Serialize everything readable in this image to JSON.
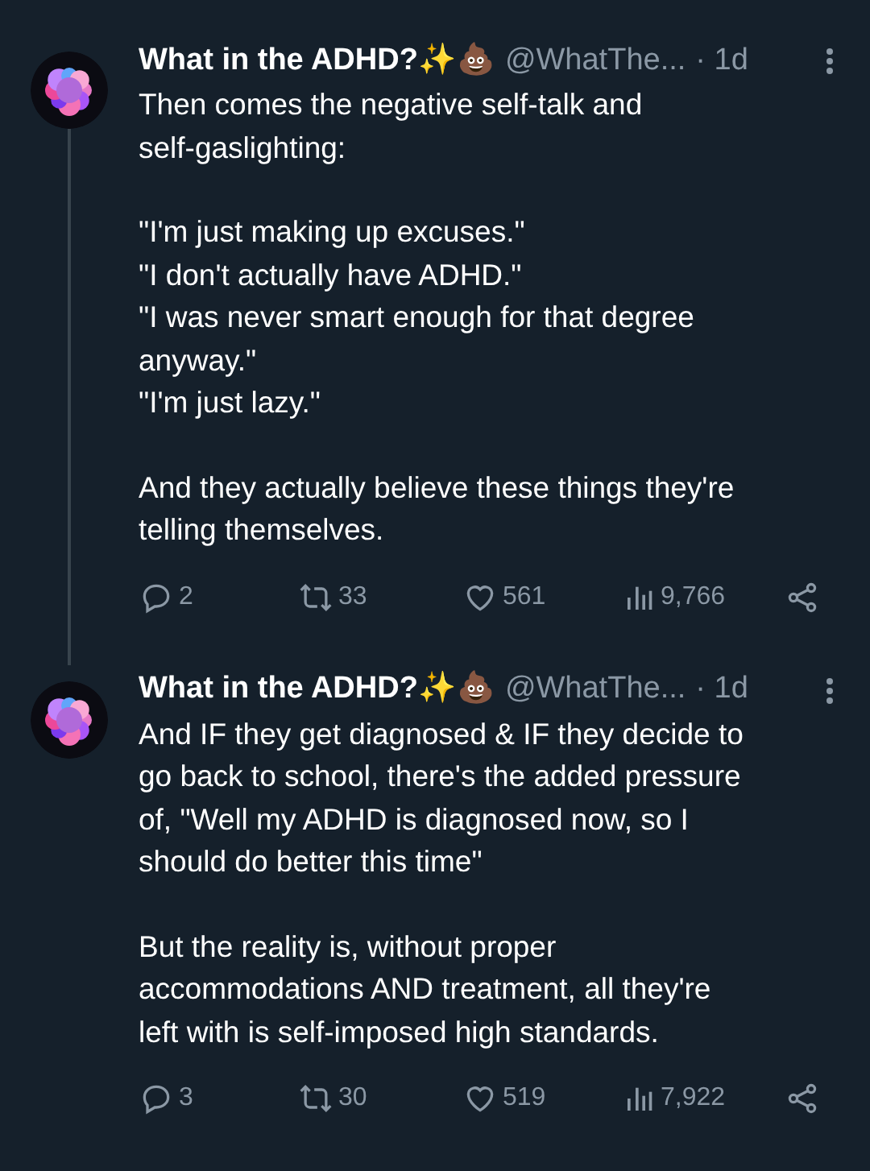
{
  "tweets": [
    {
      "name": "What in the ADHD?✨💩",
      "handle": "@WhatThe...",
      "time": "· 1d",
      "paragraphs": [
        "Then comes the negative self-talk and\nself-gaslighting:",
        "\"I'm just making up excuses.\"\n\"I don't actually have ADHD.\"\n\"I was never smart enough for that degree\nanyway.\"\n\"I'm just lazy.\"",
        "And they actually believe these things they're\ntelling themselves."
      ],
      "replies": "2",
      "reposts": "33",
      "likes": "561",
      "views": "9,766"
    },
    {
      "name": "What in the ADHD?✨💩",
      "handle": "@WhatThe...",
      "time": "· 1d",
      "paragraphs": [
        "And IF they get diagnosed & IF they decide to\ngo back to school, there's the added pressure\nof, \"Well my ADHD is diagnosed now, so I\nshould do better this time\"",
        "But the reality is, without proper\naccommodations AND treatment, all they're\nleft with is self-imposed high standards."
      ],
      "replies": "3",
      "reposts": "30",
      "likes": "519",
      "views": "7,922"
    }
  ]
}
